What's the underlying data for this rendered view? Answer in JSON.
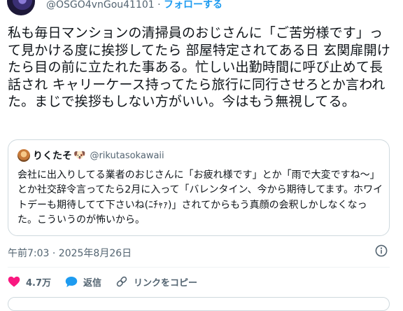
{
  "tweet": {
    "handle": "@OSGO4vnGou41101",
    "separator": "·",
    "follow_label": "フォローする",
    "text": "私も毎日マンションの清掃員のおじさんに「ご苦労様です」って見かける度に挨拶してたら 部屋特定されてある日 玄関扉開けたら目の前に立たれた事ある。忙しい出勤時間に呼び止めて長話され キャリーケース持ってたら旅行に同行させろとか言われた。まじで挨拶もしない方がいい。今はもう無視してる。",
    "timestamp": "午前7:03 · 2025年8月26日"
  },
  "quote": {
    "name": "りくたそ",
    "name_emoji": "🐶",
    "handle": "@rikutasokawaii",
    "text": "会社に出入りしてる業者のおじさんに「お疲れ様です」とか「雨で大変ですね〜」とか社交辞令言ってたら2月に入って「バレンタイン、今から期待してます。ホワイトデーも期待してて下さいね(ﾆﾁｬｧ)」されてからもう真顔の会釈しかしなくなった。こういうのが怖いから。"
  },
  "actions": {
    "like_count": "4.7万",
    "reply_label": "返信",
    "copy_link_label": "リンクをコピー"
  },
  "colors": {
    "accent": "#1d9bf0",
    "like": "#f91880",
    "muted": "#536471"
  },
  "icons": [
    "heart-icon",
    "reply-bubble-icon",
    "link-icon",
    "info-icon"
  ]
}
